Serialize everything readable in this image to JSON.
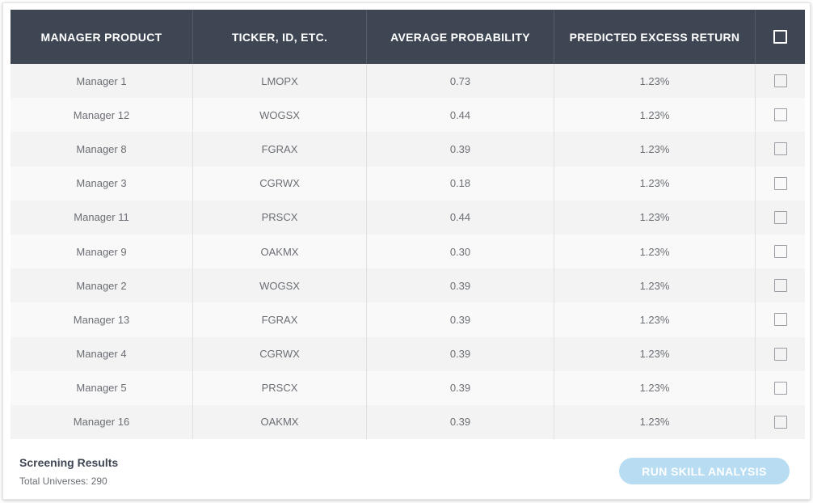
{
  "table": {
    "headers": [
      "MANAGER PRODUCT",
      "TICKER, ID, ETC.",
      "AVERAGE PROBABILITY",
      "PREDICTED EXCESS RETURN"
    ],
    "rows": [
      {
        "manager": "Manager 1",
        "ticker": "LMOPX",
        "probability": "0.73",
        "excess_return": "1.23%"
      },
      {
        "manager": "Manager 12",
        "ticker": "WOGSX",
        "probability": "0.44",
        "excess_return": "1.23%"
      },
      {
        "manager": "Manager 8",
        "ticker": "FGRAX",
        "probability": "0.39",
        "excess_return": "1.23%"
      },
      {
        "manager": "Manager 3",
        "ticker": "CGRWX",
        "probability": "0.18",
        "excess_return": "1.23%"
      },
      {
        "manager": "Manager 11",
        "ticker": "PRSCX",
        "probability": "0.44",
        "excess_return": "1.23%"
      },
      {
        "manager": "Manager 9",
        "ticker": "OAKMX",
        "probability": "0.30",
        "excess_return": "1.23%"
      },
      {
        "manager": "Manager 2",
        "ticker": "WOGSX",
        "probability": "0.39",
        "excess_return": "1.23%"
      },
      {
        "manager": "Manager 13",
        "ticker": "FGRAX",
        "probability": "0.39",
        "excess_return": "1.23%"
      },
      {
        "manager": "Manager 4",
        "ticker": "CGRWX",
        "probability": "0.39",
        "excess_return": "1.23%"
      },
      {
        "manager": "Manager 5",
        "ticker": "PRSCX",
        "probability": "0.39",
        "excess_return": "1.23%"
      },
      {
        "manager": "Manager 16",
        "ticker": "OAKMX",
        "probability": "0.39",
        "excess_return": "1.23%"
      }
    ]
  },
  "footer": {
    "title": "Screening Results",
    "subtitle": "Total Universes: 290",
    "run_button": "RUN SKILL ANALYSIS"
  },
  "colors": {
    "header_bg": "#3f4653",
    "button_bg": "#b8ddf2",
    "row_odd": "#f3f3f3",
    "row_even": "#f9f9f9"
  }
}
